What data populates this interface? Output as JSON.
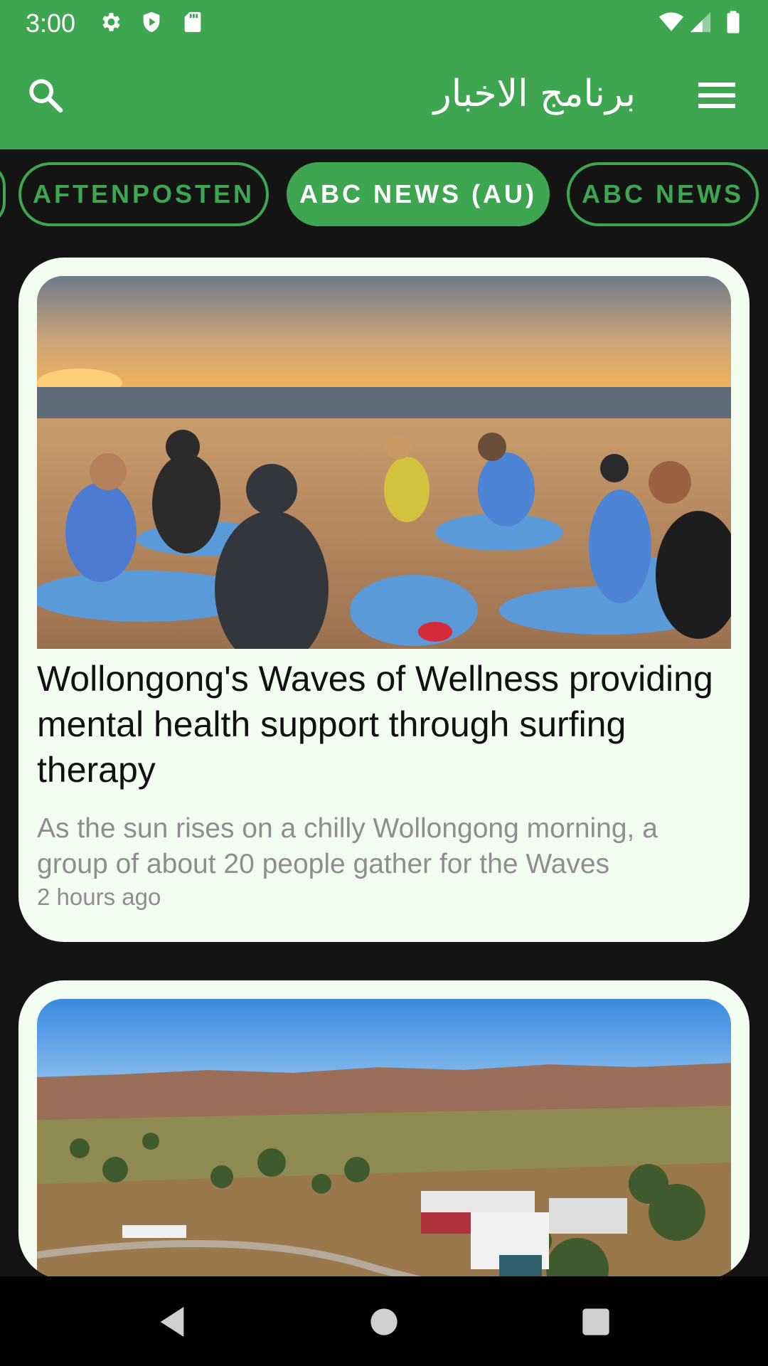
{
  "status_bar": {
    "time": "3:00",
    "icons": [
      "gear-icon",
      "shield-icon",
      "sd-card-icon",
      "wifi-icon",
      "signal-icon",
      "battery-icon"
    ]
  },
  "app_bar": {
    "title": "برنامج الاخبار",
    "search_icon": "search-icon",
    "menu_icon": "menu-icon"
  },
  "sources": {
    "chips": [
      {
        "label": "AFTENPOSTEN",
        "active": false
      },
      {
        "label": "ABC NEWS (AU)",
        "active": true
      },
      {
        "label": "ABC NEWS",
        "active": false
      }
    ]
  },
  "articles": [
    {
      "headline": "Wollongong's Waves of Wellness providing mental health support through surfing therapy",
      "description": "As the sun rises on a chilly Wollongong morning, a group of about 20 people gather for the Waves",
      "time_ago": "2 hours ago"
    }
  ],
  "colors": {
    "accent": "#3ea650",
    "background": "#141414",
    "card": "#f3fcf0",
    "muted_text": "#8e8e8e"
  }
}
